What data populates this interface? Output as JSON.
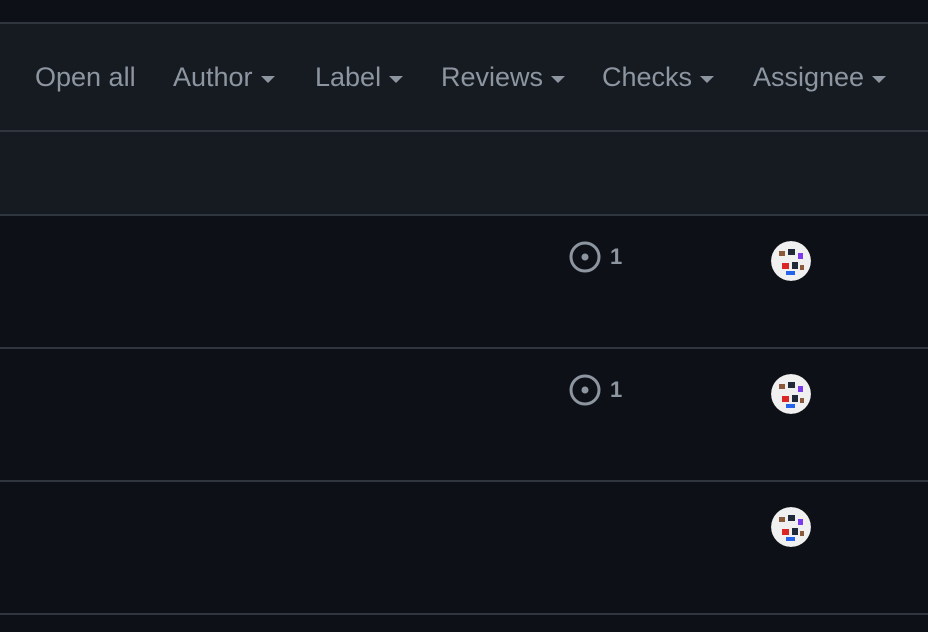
{
  "filters": [
    {
      "label": "Open all",
      "has_caret": false
    },
    {
      "label": "Author",
      "has_caret": true
    },
    {
      "label": "Label",
      "has_caret": true
    },
    {
      "label": "Reviews",
      "has_caret": true
    },
    {
      "label": "Checks",
      "has_caret": true
    },
    {
      "label": "Assignee",
      "has_caret": true
    }
  ],
  "rows": [
    {
      "review_icon": "review-status-icon",
      "review_count": "1",
      "assignee_avatar": "avatar"
    },
    {
      "review_icon": "review-status-icon",
      "review_count": "1",
      "assignee_avatar": "avatar"
    },
    {
      "assignee_avatar": "avatar"
    }
  ],
  "colors": {
    "background": "#0d1117",
    "header_background": "#161b22",
    "border": "#30363d",
    "muted_text": "#8d96a0"
  }
}
